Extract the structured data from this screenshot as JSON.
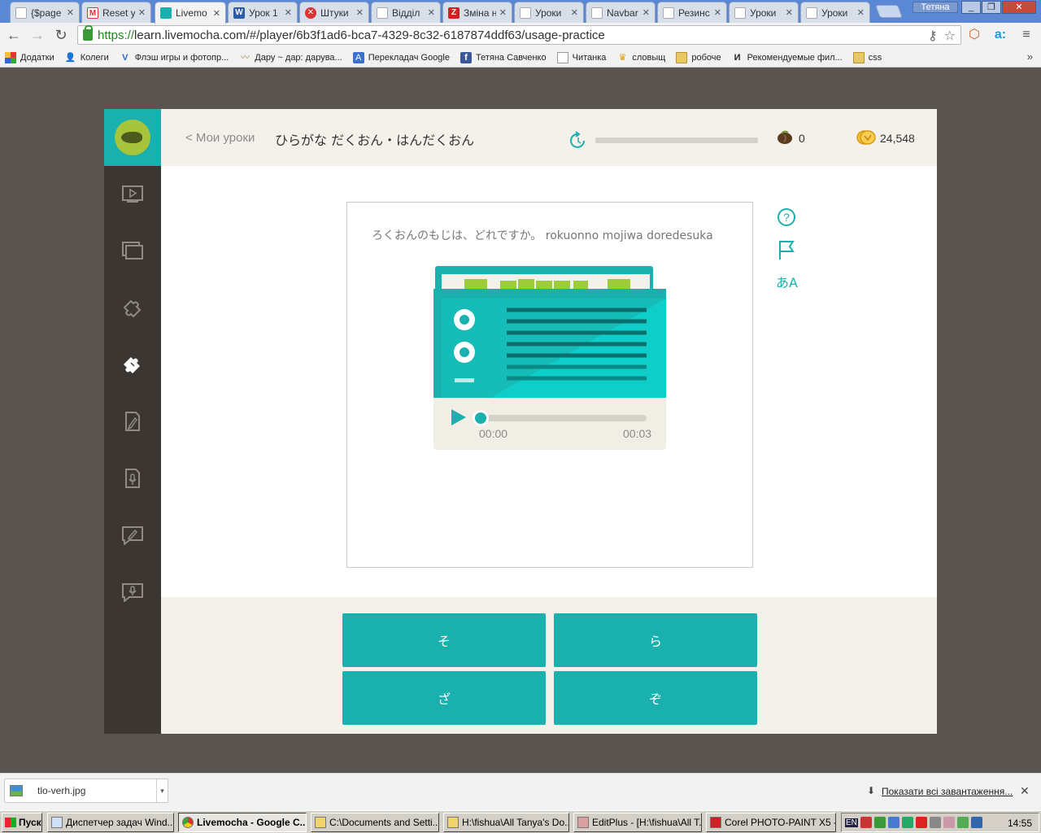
{
  "browser": {
    "tabs": [
      {
        "label": "{$page",
        "favicon": "page"
      },
      {
        "label": "Reset y",
        "favicon": "gmail"
      },
      {
        "label": "Livemo",
        "favicon": "livemocha",
        "active": true
      },
      {
        "label": "Урок 1",
        "favicon": "word"
      },
      {
        "label": "Штуки",
        "favicon": "x-red"
      },
      {
        "label": "Відділ",
        "favicon": "page"
      },
      {
        "label": "Зміна н",
        "favicon": "znu"
      },
      {
        "label": "Уроки",
        "favicon": "page"
      },
      {
        "label": "Navbar",
        "favicon": "page"
      },
      {
        "label": "Резинс",
        "favicon": "page"
      },
      {
        "label": "Уроки",
        "favicon": "page"
      },
      {
        "label": "Уроки",
        "favicon": "page"
      }
    ],
    "user_name": "Тетяна",
    "url_scheme": "https://",
    "url_rest": "learn.livemocha.com/#/player/6b3f1ad6-bca7-4329-8c32-6187874ddf63/usage-practice",
    "bookmarks": [
      {
        "label": "Додатки",
        "icon": "apps-grid-icon"
      },
      {
        "label": "Колеги",
        "icon": "person-icon"
      },
      {
        "label": "Флэш игры и фотопр...",
        "icon": "v-icon"
      },
      {
        "label": "Дару ~ дар: дарува...",
        "icon": "mustache-icon"
      },
      {
        "label": "Перекладач Google",
        "icon": "translate-icon"
      },
      {
        "label": "Тетяна Савченко",
        "icon": "facebook-icon"
      },
      {
        "label": "Читанка",
        "icon": "page-icon"
      },
      {
        "label": "словыщ",
        "icon": "crown-icon"
      },
      {
        "label": "робоче",
        "icon": "folder-icon"
      },
      {
        "label": "Рекомендуемые фил...",
        "icon": "i-icon"
      },
      {
        "label": "css",
        "icon": "folder-icon"
      }
    ]
  },
  "header": {
    "back_link": "< Мои уроки",
    "lesson_title": "ひらがな だくおん・はんだくおん",
    "progress_fraction": 0,
    "acorns": "0",
    "coins": "24,548"
  },
  "sidebar": {
    "items": [
      "video-icon",
      "cards-icon",
      "puzzle-icon",
      "puzzle-active-icon",
      "writing-icon",
      "speaking-icon",
      "review-icon",
      "mic-chat-icon"
    ],
    "active_index": 3
  },
  "exercise": {
    "question": "ろくおんのもじは、どれですか。 rokuonno mojiwa doredesuka",
    "time_current": "00:00",
    "time_total": "00:03",
    "playback_fraction": 0
  },
  "tools": {
    "help": "?",
    "kana_toggle": "あA"
  },
  "answers": [
    "そ",
    "ら",
    "ざ",
    "ぞ"
  ],
  "downloads": {
    "file_name": "tlo-verh.jpg",
    "show_all": "Показати всі завантаження..."
  },
  "taskbar": {
    "start": "Пуск",
    "tasks": [
      "Диспетчер задач Wind...",
      "Livemocha - Google C...",
      "C:\\Documents and Setti...",
      "H:\\fishua\\All Tanya's Do...",
      "EditPlus - [H:\\fishua\\All T...",
      "Corel PHOTO-PAINT X5 -..."
    ],
    "active_task": 1,
    "lang": "EN",
    "clock": "14:55"
  },
  "colors": {
    "accent": "#19b0ad",
    "sidebar": "#3c3632",
    "header_bg": "#f4f1eb",
    "backdrop": "#5a5450"
  }
}
